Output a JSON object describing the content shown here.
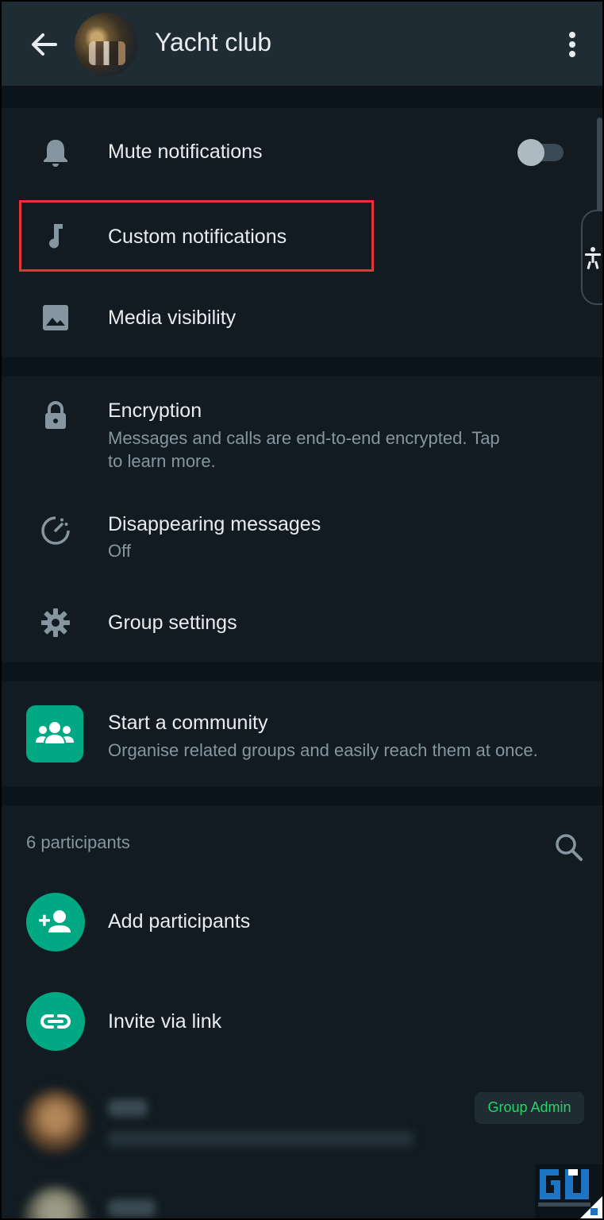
{
  "header": {
    "title": "Yacht club",
    "back_icon": "arrow-left-icon",
    "menu_icon": "more-vert-icon"
  },
  "notifications_section": {
    "mute_label": "Mute notifications",
    "mute_enabled": false,
    "custom_label": "Custom notifications",
    "media_label": "Media visibility"
  },
  "privacy_section": {
    "encryption_title": "Encryption",
    "encryption_sub_line1": "Messages and calls are end-to-end encrypted. Tap",
    "encryption_sub_line2": "to learn more.",
    "disappearing_title": "Disappearing messages",
    "disappearing_value": "Off",
    "group_settings_label": "Group settings"
  },
  "community": {
    "title": "Start a community",
    "subtitle": "Organise related groups and easily reach them at once."
  },
  "participants": {
    "count_label": "6 participants",
    "add_label": "Add participants",
    "invite_label": "Invite via link",
    "admin_badge": "Group Admin"
  },
  "colors": {
    "accent": "#00a884",
    "highlight": "#e8323b",
    "background": "#0b141a",
    "surface": "#111b21"
  }
}
